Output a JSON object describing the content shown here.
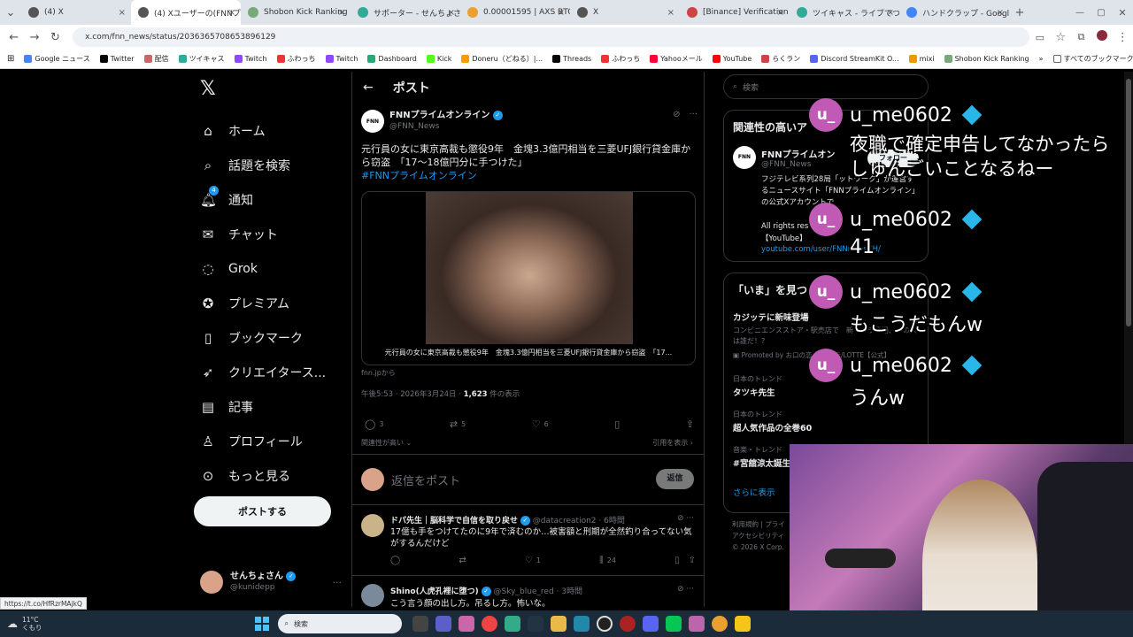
{
  "browser": {
    "tabs": [
      {
        "label": "(4) X"
      },
      {
        "label": "(4) Xユーザーの(FNNプラ"
      },
      {
        "label": "Shobon Kick Ranking"
      },
      {
        "label": "サポーター - せんちょさん"
      },
      {
        "label": "0.00001595 | AXS BTC"
      },
      {
        "label": "X"
      },
      {
        "label": "[Binance] Verification"
      },
      {
        "label": "ツイキャス - ライブでつな"
      },
      {
        "label": "ハンドクラップ - Google"
      }
    ],
    "url": "x.com/fnn_news/status/2036365708653896129",
    "bookmarks": [
      "Google ニュース",
      "Twitter",
      "配信",
      "ツイキャス",
      "Twitch",
      "ふわっち",
      "Twitch",
      "Dashboard",
      "Kick",
      "Doneru（どねる）|...",
      "Threads",
      "ふわっち",
      "Yahooメール",
      "YouTube",
      "らくラン",
      "Discord StreamKit O...",
      "mixi",
      "Shobon Kick Ranking"
    ],
    "all_bookmarks": "すべてのブックマーク"
  },
  "nav": {
    "items": [
      {
        "label": "ホーム"
      },
      {
        "label": "話題を検索"
      },
      {
        "label": "通知",
        "badge": "4"
      },
      {
        "label": "チャット"
      },
      {
        "label": "Grok"
      },
      {
        "label": "プレミアム"
      },
      {
        "label": "ブックマーク"
      },
      {
        "label": "クリエイタース..."
      },
      {
        "label": "記事"
      },
      {
        "label": "プロフィール"
      },
      {
        "label": "もっと見る"
      }
    ],
    "post_button": "ポストする",
    "account": {
      "name": "せんちょさん",
      "handle": "@kunidepp"
    }
  },
  "main": {
    "header": "ポスト",
    "post": {
      "author": "FNNプライムオンライン",
      "handle": "@FNN_News",
      "text": "元行員の女に東京高裁も懲役9年　金塊3.3億円相当を三菱UFJ銀行貸金庫から窃盗　「17～18億円分に手つけた」",
      "hashtag": "#FNNプライムオンライン",
      "media_caption": "元行員の女に東京高裁も懲役9年　金塊3.3億円相当を三菱UFJ銀行貸金庫から窃盗　「17...",
      "source": "fnn.jpから",
      "timestamp": "午後5:53 · 2026年3月24日 · ",
      "views": "1,623",
      "views_label": " 件の表示",
      "replies": "3",
      "reposts": "5",
      "likes": "6",
      "relevance": "関連性が高い",
      "view_quotes": "引用を表示"
    },
    "reply_placeholder": "返信をポスト",
    "reply_button": "返信",
    "replies": [
      {
        "author": "ドパ先生｜脳科学で自信を取り戻せ",
        "handle": "@datacreation2 · 6時間",
        "text": "17億も手をつけてたのに9年で済むのか…被害額と刑期が全然釣り合ってない気がするんだけど",
        "replies": "",
        "reposts": "",
        "likes": "1",
        "views": "24"
      },
      {
        "author": "Shino(人虎孔裡に堕つ)",
        "handle": "@Sky_blue_red · 3時間",
        "text": "こう言う顔の出し方。吊るし方。怖いな。"
      }
    ]
  },
  "right": {
    "search_placeholder": "検索",
    "related_title": "関連性の高いア",
    "related_account": {
      "name": "FNNプライムオン",
      "handle": "@FNN_News",
      "follow": "フォロー",
      "bio": "フジテレビ系列28局「ットワーク」が運営するニュースサイト「FNNプライムオンライン」の公式Xアカウントで",
      "rights": "All rights res",
      "youtube_label": "【YouTube】",
      "youtube_link": "youtube.com/user/FNNnewsCH/"
    },
    "trends_title": "「いま」を見つ",
    "promo": {
      "title": "カジッテに新味登場",
      "text": "コンビニエンスストア・駅売店で　新キャラ登場、中の人は誰だ！？",
      "promoted": "Promoted by お口の恋人 ロッテ/LOTTE【公式】"
    },
    "trends": [
      {
        "category": "日本のトレンド",
        "name": "タツキ先生"
      },
      {
        "category": "日本のトレンド",
        "name": "超人気作品の全巻60"
      },
      {
        "category": "音楽・トレンド",
        "name": "#宮舘涼太誕生"
      }
    ],
    "show_more": "さらに表示",
    "footer": [
      "利用規約",
      "プライ",
      "アクセシビリティ",
      "© 2026 X Corp."
    ]
  },
  "overlay": {
    "comments": [
      {
        "user": "u_me0602",
        "avatar": "u_",
        "message": "夜職で確定申告してなかったらしゅんごいことなるねー"
      },
      {
        "user": "u_me0602",
        "avatar": "u_",
        "message": "41"
      },
      {
        "user": "u_me0602",
        "avatar": "u_",
        "message": "もこうだもんw"
      },
      {
        "user": "u_me0602",
        "avatar": "u_",
        "message": "うんw"
      }
    ]
  },
  "status_link": "https://t.co/HfRzrMAjkQ",
  "taskbar": {
    "weather_temp": "11°C",
    "weather_desc": "くもり",
    "search_placeholder": "検索"
  }
}
